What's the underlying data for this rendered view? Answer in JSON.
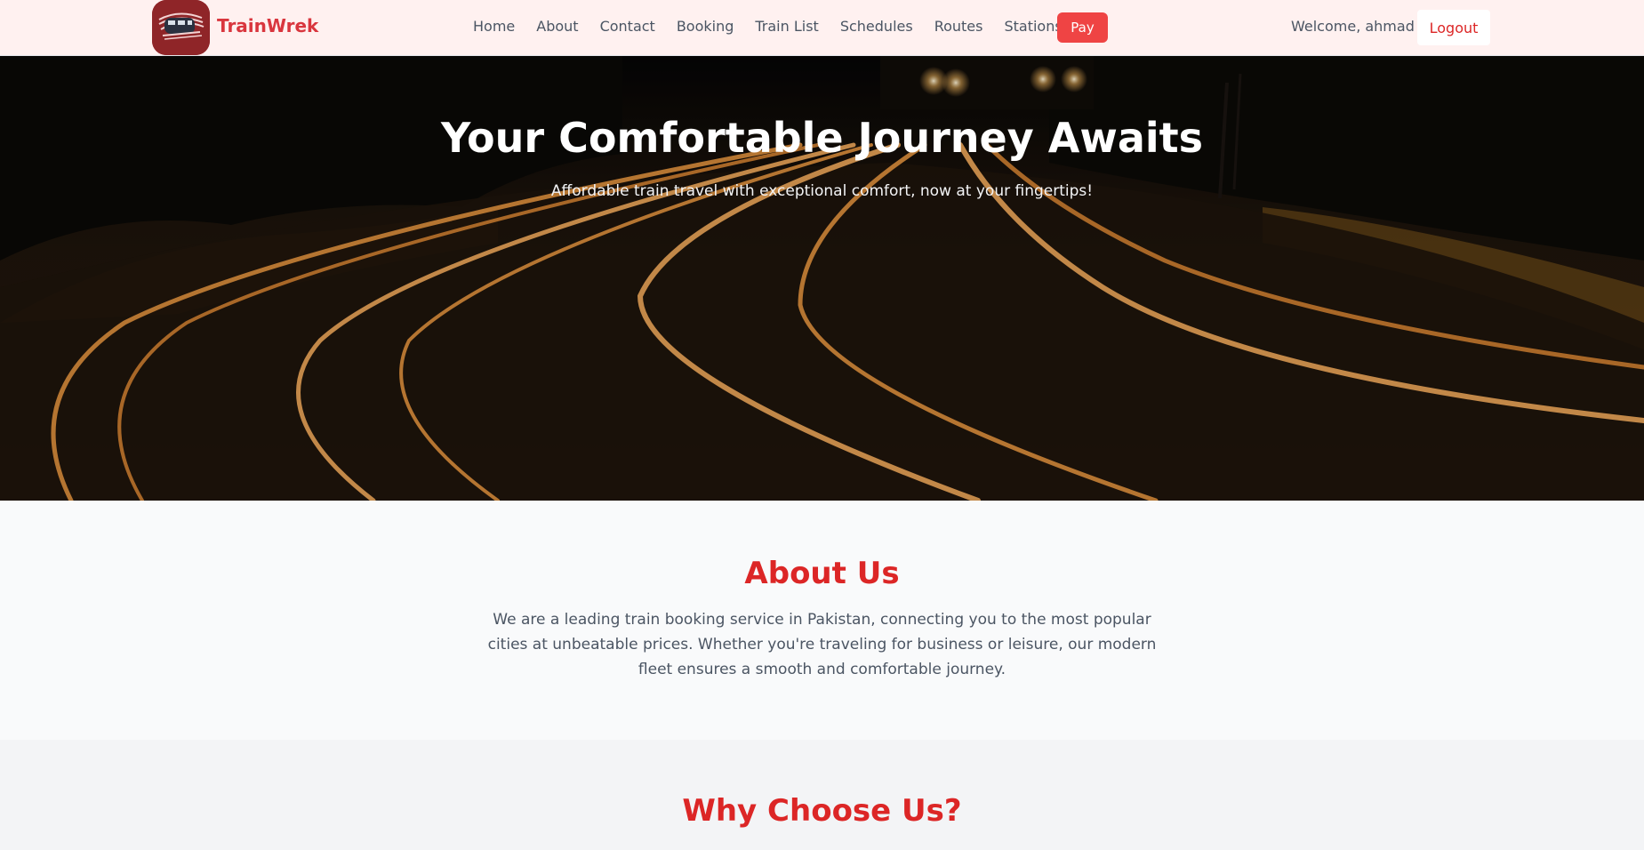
{
  "nav": {
    "brand": "TrainWrek",
    "links": [
      "Home",
      "About",
      "Contact",
      "Booking",
      "Train List",
      "Schedules",
      "Routes",
      "Stations"
    ],
    "pay_label": "Pay",
    "welcome": "Welcome, ahmad",
    "logout_label": "Logout"
  },
  "hero": {
    "title": "Your Comfortable Journey Awaits",
    "subtitle": "Affordable train travel with exceptional comfort, now at your fingertips!"
  },
  "about": {
    "title": "About Us",
    "text": "We are a leading train booking service in Pakistan, connecting you to the most popular cities at unbeatable prices. Whether you're traveling for business or leisure, our modern fleet ensures a smooth and comfortable journey."
  },
  "why": {
    "title": "Why Choose Us?"
  },
  "colors": {
    "accent": "#dc2626",
    "pay_button": "#ef4444",
    "nav_background": "#fff1f0"
  },
  "icons": {
    "logo": "train-logo-icon"
  }
}
